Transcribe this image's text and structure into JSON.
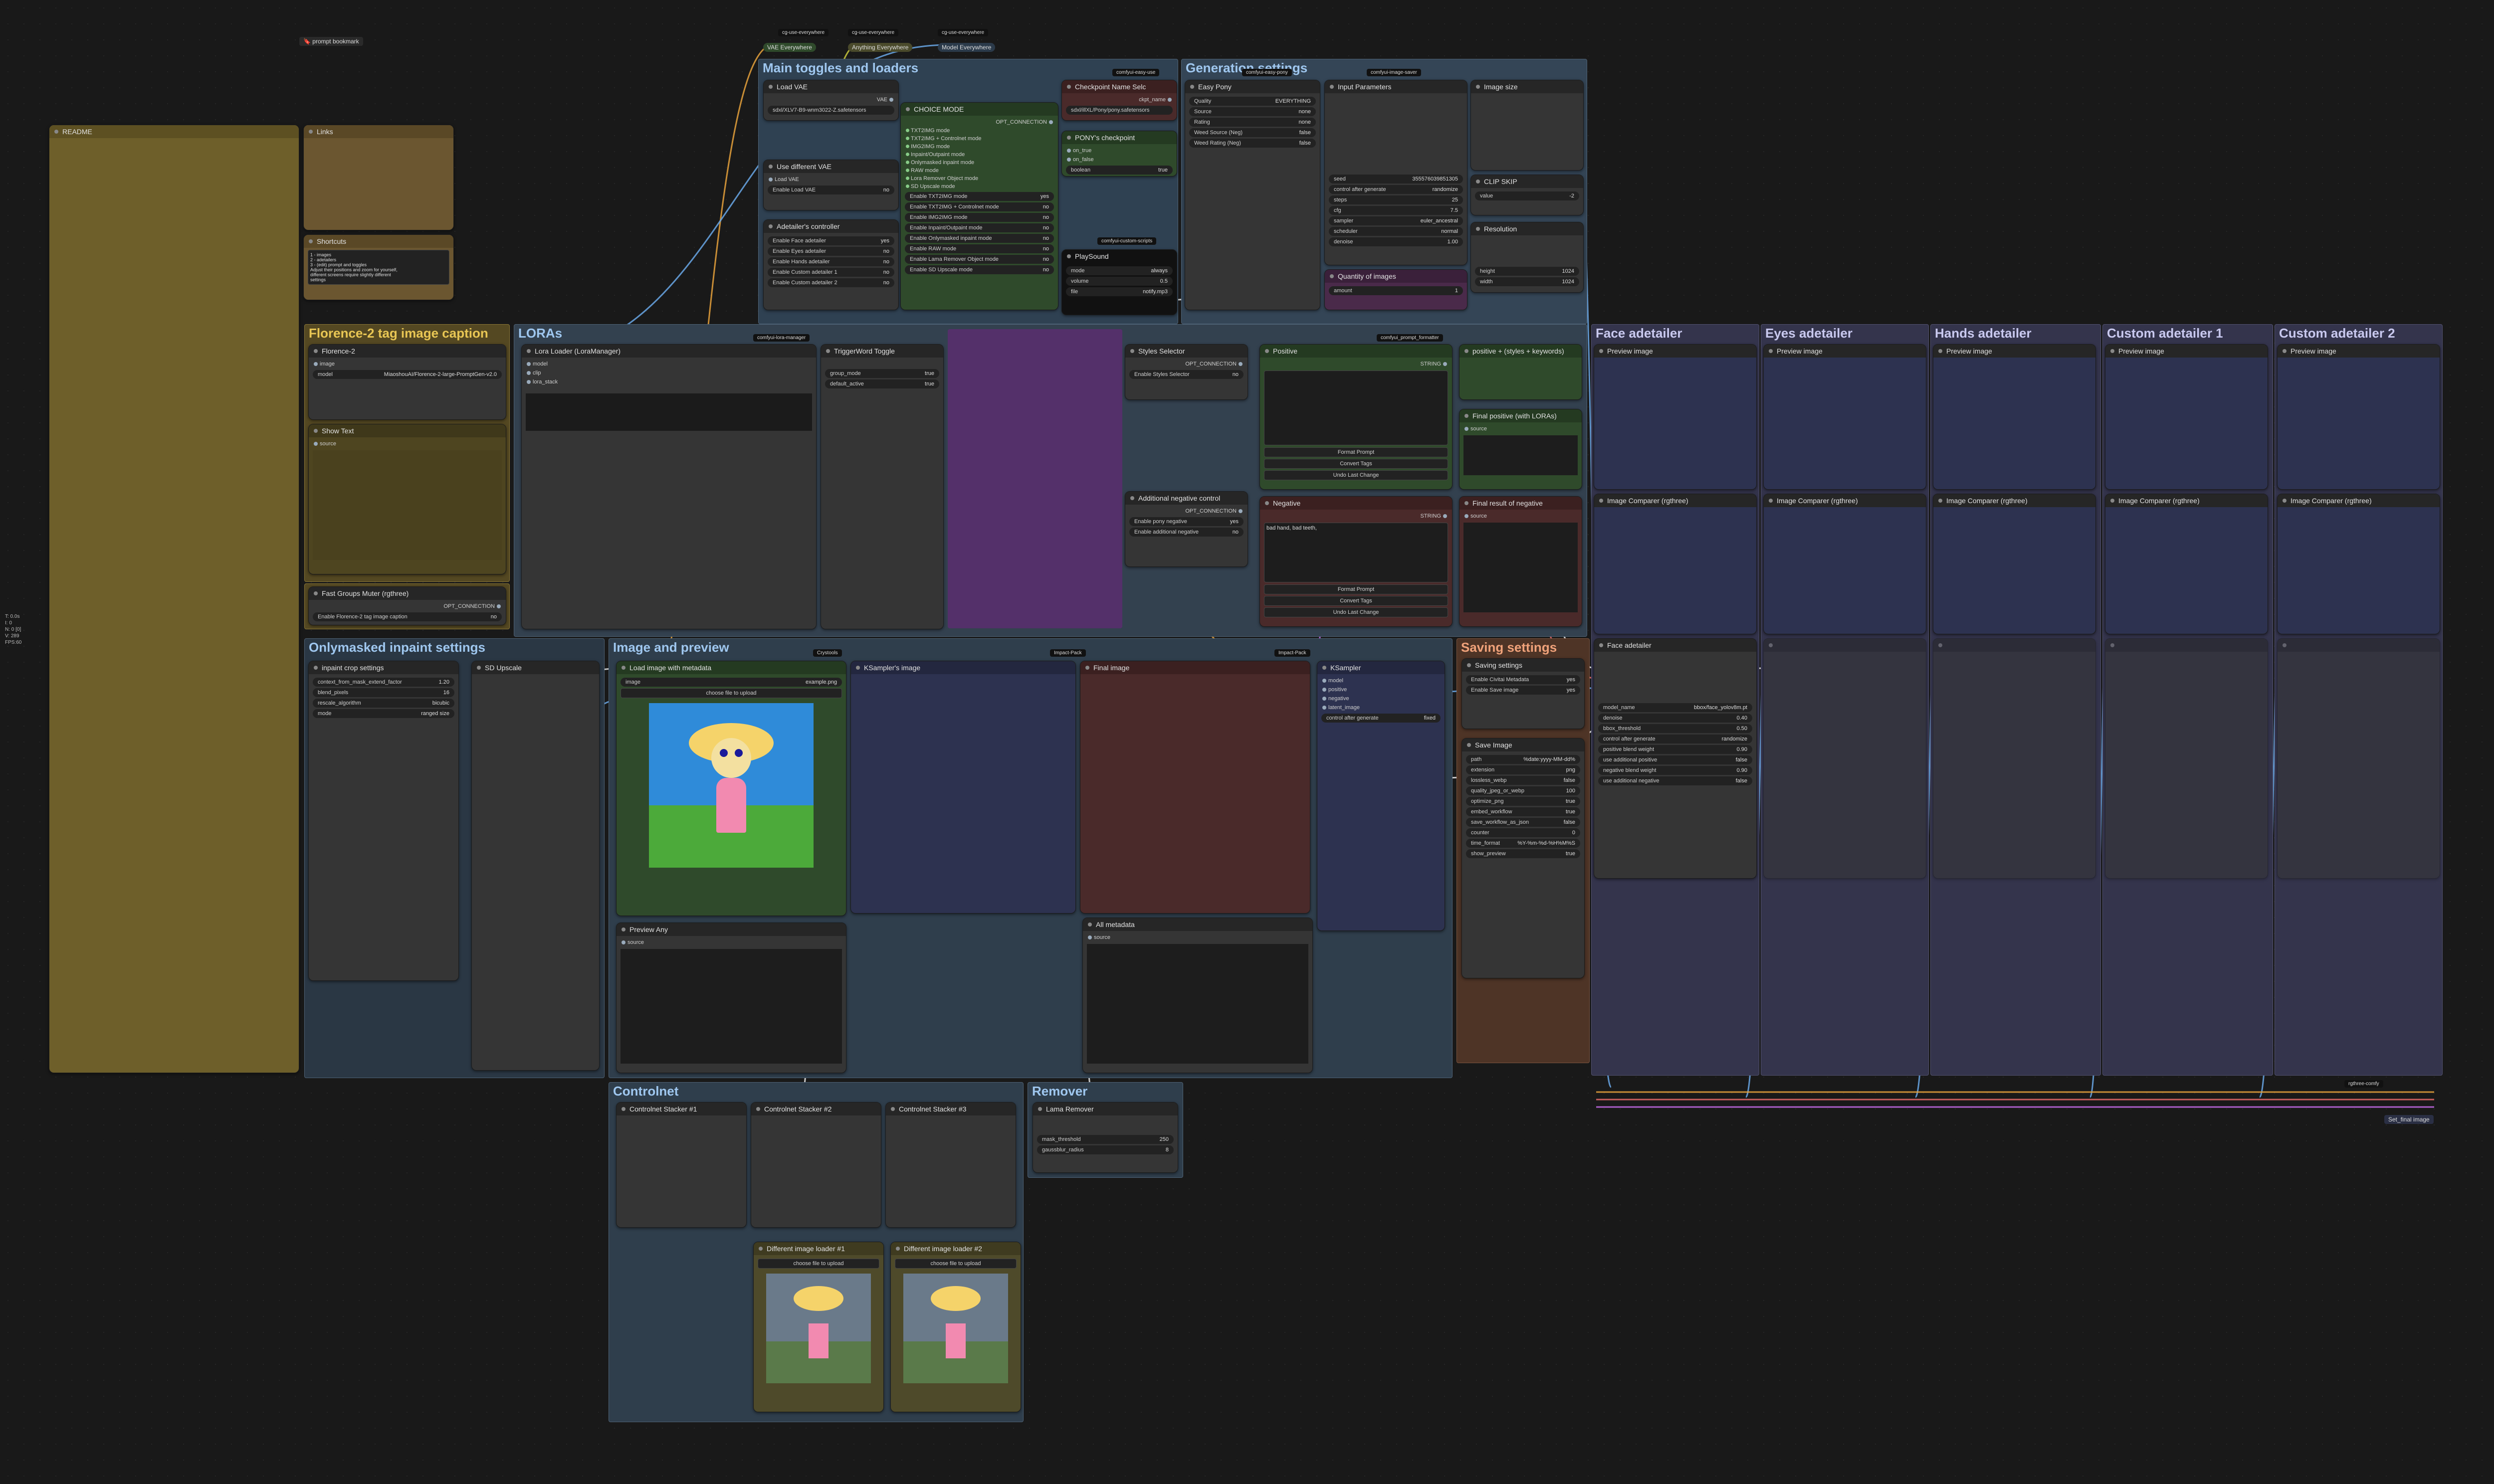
{
  "colors": {
    "main_group": "#3b4d5e",
    "readme": "#73622e",
    "links": "#6b5630",
    "florence_group": "#5c4d1f",
    "lora_group": "#3a4a5c",
    "violet": "#7a3c86",
    "adetailer_group": "#3d3d56",
    "saving_group": "#5a3a2a",
    "green_node": "#2f4a2b",
    "red_node": "#4a2a2a",
    "blue_node": "#2d3250"
  },
  "bookmark": {
    "label": "prompt bookmark"
  },
  "everywhere_tags": [
    {
      "pack": "cg-use-everywhere",
      "label": "VAE Everywhere"
    },
    {
      "pack": "cg-use-everywhere",
      "label": "Anything Everywhere"
    },
    {
      "pack": "cg-use-everywhere",
      "label": "Model Everywhere"
    }
  ],
  "groups": {
    "main_toggles": "Main toggles and loaders",
    "generation": "Generation settings",
    "florence": "Florence-2 tag image caption",
    "loras": "LORAs",
    "onlymasked": "Onlymasked inpaint settings",
    "image_preview": "Image and preview",
    "saving": "Saving settings",
    "controlnet": "Controlnet",
    "remover": "Remover",
    "face": "Face adetailer",
    "eyes": "Eyes adetailer",
    "hands": "Hands adetailer",
    "custom1": "Custom adetailer 1",
    "custom2": "Custom adetailer 2"
  },
  "nodes": {
    "readme": "README",
    "links": "Links",
    "shortcuts": "Shortcuts",
    "shortcuts_text": "1 - images\n2 - adetailers\n3 - (edit) prompt and toggles\nAdjust their positions and zoom for yourself,\ndifferent screens require slightly different\nsettings",
    "load_vae": "Load VAE",
    "load_vae_value": "sdxl/XLV7-B9-wnm3022-Z.safetensors",
    "use_diff_vae": "Use different VAE",
    "enable_load_vae": "Enable Load VAE",
    "choice_mode": "CHOICE MODE",
    "opt_connection": "OPT_CONNECTION",
    "modes": [
      "TXT2IMG mode",
      "TXT2IMG + Controlnet mode",
      "IMG2IMG mode",
      "Inpaint/Outpaint mode",
      "Onlymasked inpaint mode",
      "RAW mode",
      "Lora Remover Object mode",
      "SD Upscale mode"
    ],
    "mode_toggles": [
      {
        "label": "Enable TXT2IMG mode",
        "value": "yes"
      },
      {
        "label": "Enable TXT2IMG + Controlnet mode",
        "value": "no"
      },
      {
        "label": "Enable IMG2IMG mode",
        "value": "no"
      },
      {
        "label": "Enable Inpaint/Outpaint mode",
        "value": "no"
      },
      {
        "label": "Enable Onlymasked inpaint mode",
        "value": "no"
      },
      {
        "label": "Enable RAW mode",
        "value": "no"
      },
      {
        "label": "Enable Lama Remover Object mode",
        "value": "no"
      },
      {
        "label": "Enable SD Upscale mode",
        "value": "no"
      }
    ],
    "adetailers_ctrl": "Adetailer's controller",
    "adetailer_toggles": [
      {
        "label": "Enable Face adetailer",
        "value": "yes"
      },
      {
        "label": "Enable Eyes adetailer",
        "value": "no"
      },
      {
        "label": "Enable Hands adetailer",
        "value": "no"
      },
      {
        "label": "Enable Custom adetailer 1",
        "value": "no"
      },
      {
        "label": "Enable Custom adetailer 2",
        "value": "no"
      }
    ],
    "checkpoint_name": "Checkpoint Name Selc",
    "ckpt_name_label": "ckpt_name",
    "ckpt_name_value": "sdxl/illXL/Pony/pony.safetensors",
    "pony_checkpoint": "PONY's checkpoint",
    "on_true": "on_true",
    "on_false": "on_false",
    "boolean": "boolean",
    "boolean_value": "true",
    "playsound": "PlaySound",
    "playsound_vals": [
      {
        "label": "mode",
        "value": "always"
      },
      {
        "label": "volume",
        "value": "0.5"
      },
      {
        "label": "file",
        "value": "notify.mp3"
      }
    ],
    "easy_pony": "Easy Pony",
    "input_params": "Input Parameters",
    "image_size": "Image size",
    "resolution": "Resolution",
    "clip_skip": "CLIP SKIP",
    "seed_value": "355576039851305",
    "gen_vals": [
      {
        "label": "seed",
        "value": "355576039851305"
      },
      {
        "label": "control after generate",
        "value": "randomize"
      },
      {
        "label": "steps",
        "value": "25"
      },
      {
        "label": "cfg",
        "value": "7.5"
      },
      {
        "label": "sampler",
        "value": "euler_ancestral"
      },
      {
        "label": "scheduler",
        "value": "normal"
      },
      {
        "label": "denoise",
        "value": "1.00"
      }
    ],
    "pony_vals": [
      {
        "label": "Quality",
        "value": "EVERYTHING"
      },
      {
        "label": "Source",
        "value": "none"
      },
      {
        "label": "Rating",
        "value": "none"
      },
      {
        "label": "Weed Source (Neg)",
        "value": "false"
      },
      {
        "label": "Weed Rating (Neg)",
        "value": "false"
      }
    ],
    "res_vals": [
      {
        "label": "height",
        "value": "1024"
      },
      {
        "label": "width",
        "value": "1024"
      }
    ],
    "clip_value": "-2",
    "quantity": "Quantity of images",
    "quantity_value": "1",
    "florence_node": "Florence-2",
    "florence_model": "MiaoshouAI/Florence-2-large-PromptGen-v2.0",
    "show_text": "Show Text",
    "fast_groups_muter": "Fast Groups Muter (rgthree)",
    "enable_florence": "Enable Florence-2 tag image caption",
    "lora_loader": "Lora Loader (LoraManager)",
    "trigger_toggle": "TriggerWord Toggle",
    "trigger_vals": [
      {
        "label": "group_mode",
        "value": "true"
      },
      {
        "label": "default_active",
        "value": "true"
      }
    ],
    "styles_selector": "Styles Selector",
    "enable_styles": "Enable Styles Selector",
    "positive": "Positive",
    "negative": "Negative",
    "negative_text": "bad hand, bad teeth,",
    "format_prompt": "Format Prompt",
    "convert_tags": "Convert Tags",
    "undo_last": "Undo Last Change",
    "positive_concat": "positive + (styles + keywords)",
    "final_positive": "Final positive (with LORAs)",
    "final_negative": "Final result of negative",
    "additional_neg": "Additional negative control",
    "enable_pony_neg": "Enable pony negative",
    "enable_add_neg": "Enable additional negative",
    "ksampler": "KSampler",
    "ksampler_seed_mode": "fixed",
    "load_image": "Load image with metadata",
    "image_file": "example.png",
    "choose_upload": "choose file to upload",
    "ksampler_image": "KSampler's image",
    "final_image": "Final image",
    "preview_any": "Preview Any",
    "all_metadata": "All metadata",
    "saving_settings": "Saving settings",
    "enable_civitai": "Enable Civitai Metadata",
    "enable_save": "Enable Save image",
    "save_image": "Save Image",
    "save_vals": [
      {
        "label": "path",
        "value": "%date:yyyy-MM-dd%"
      },
      {
        "label": "extension",
        "value": "png"
      },
      {
        "label": "lossless_webp",
        "value": "false"
      },
      {
        "label": "quality_jpeg_or_webp",
        "value": "100"
      },
      {
        "label": "optimize_png",
        "value": "true"
      },
      {
        "label": "embed_workflow",
        "value": "true"
      },
      {
        "label": "save_workflow_as_json",
        "value": "false"
      },
      {
        "label": "counter",
        "value": "0"
      },
      {
        "label": "time_format",
        "value": "%Y-%m-%d-%H%M%S"
      },
      {
        "label": "show_preview",
        "value": "true"
      }
    ],
    "detailer_preview": "Preview image",
    "image_compare": "Image Comparer (rgthree)",
    "face_detailer": "Face adetailer",
    "face_vals": [
      {
        "label": "model_name",
        "value": "bbox/face_yolov8m.pt"
      },
      {
        "label": "denoise",
        "value": "0.40"
      },
      {
        "label": "bbox_threshold",
        "value": "0.50"
      },
      {
        "label": "control after generate",
        "value": "randomize"
      },
      {
        "label": "positive blend weight",
        "value": "0.90"
      },
      {
        "label": "use additional positive",
        "value": "false"
      },
      {
        "label": "negative blend weight",
        "value": "0.90"
      },
      {
        "label": "use additional negative",
        "value": "false"
      }
    ],
    "onlymasked_vals": [
      "inpaint crop settings",
      "context_from_mask_extend_factor",
      "blend_pixels",
      "rescale_algorithm",
      "mode"
    ],
    "controlnet_stack": "Controlnet Stacker #1",
    "controlnet_stack2": "Controlnet Stacker #2",
    "controlnet_stack3": "Controlnet Stacker #3",
    "different_img1": "Different image loader #1",
    "different_img2": "Different image loader #2",
    "lama_remover": "Lama Remover",
    "lama_vals": [
      {
        "label": "mask_threshold",
        "value": "250"
      },
      {
        "label": "gaussblur_radius",
        "value": "8"
      }
    ],
    "set_final": "Set_final image"
  },
  "packs": {
    "easy_use": "comfyui-easy-use",
    "easy_pony": "comfyui-easy-pony",
    "image_saver": "comfyui-image-saver",
    "custom_scripts": "comfyui-custom-scripts",
    "lora_manager": "comfyui-lora-manager",
    "prompt_formatter": "comfyui_prompt_formatter",
    "impact": "Impact-Pack",
    "rgthree": "rgthree-comfy",
    "crystools": "Crystools"
  },
  "side_stats": [
    "T: 0.0s",
    "I: 0",
    "N: 0 [0]",
    "V: 289",
    "FPS:60"
  ]
}
